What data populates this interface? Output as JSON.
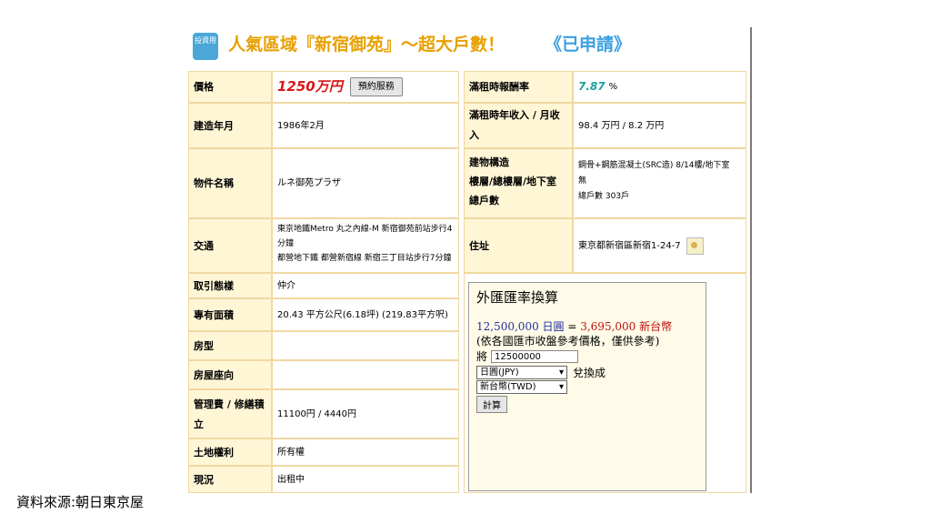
{
  "header": {
    "badge": "投資用",
    "title": "人氣區域『新宿御苑』～超大戶數！",
    "status": "《已申請》"
  },
  "left_rows": [
    {
      "label": "價格",
      "price": "1250万円",
      "button": "預約服務"
    },
    {
      "label": "建造年月",
      "value": "1986年2月"
    },
    {
      "label": "物件名稱",
      "value": "ルネ御苑プラザ"
    },
    {
      "label": "交通",
      "value_lines": [
        "東京地鐵Metro 丸之內線-M 新宿御苑前站步行4",
        "分鐘",
        "都營地下鐵 都營新宿線 新宿三丁目站步行7分鐘"
      ]
    },
    {
      "label": "取引態樣",
      "value": "仲介"
    },
    {
      "label": "專有面積",
      "value": "20.43 平方公尺(6.18坪) (219.83平方呎)"
    },
    {
      "label": "房型",
      "value": ""
    },
    {
      "label": "房屋座向",
      "value": ""
    },
    {
      "label_lines": [
        "管理費 / 修繕積",
        "立"
      ],
      "value": "11100円 / 4440円"
    },
    {
      "label": "土地權利",
      "value": "所有權"
    },
    {
      "label": "現況",
      "value": "出租中"
    }
  ],
  "right_rows": [
    {
      "label": "滿租時報酬率",
      "rate": "7.87",
      "unit": "%"
    },
    {
      "label_lines": [
        "滿租時年收入 / 月收",
        "入"
      ],
      "value": "98.4 万円 / 8.2 万円"
    },
    {
      "label_lines": [
        "建物構造",
        "樓層/總樓層/地下室",
        "總戶數"
      ],
      "value_lines": [
        "鋼骨+鋼筋混凝土(SRC造) 8/14樓/地下室",
        "無",
        "總戶數 303戶"
      ]
    },
    {
      "label": "住址",
      "value": "東京都新宿區新宿1-24-7"
    }
  ],
  "converter": {
    "title": "外匯匯率換算",
    "result_jpy": "12,500,000 日圓",
    "equals": " = ",
    "result_twd": "3,695,000 新台幣",
    "note": "(依各國匯市收盤參考價格，僅供參考)",
    "prefix": "將",
    "amount": "12500000",
    "from_currency": "日圓(JPY)",
    "suffix": "兌換成",
    "to_currency": "新台幣(TWD)",
    "calc_button": "計算"
  },
  "source": "資料來源:朝日東京屋"
}
